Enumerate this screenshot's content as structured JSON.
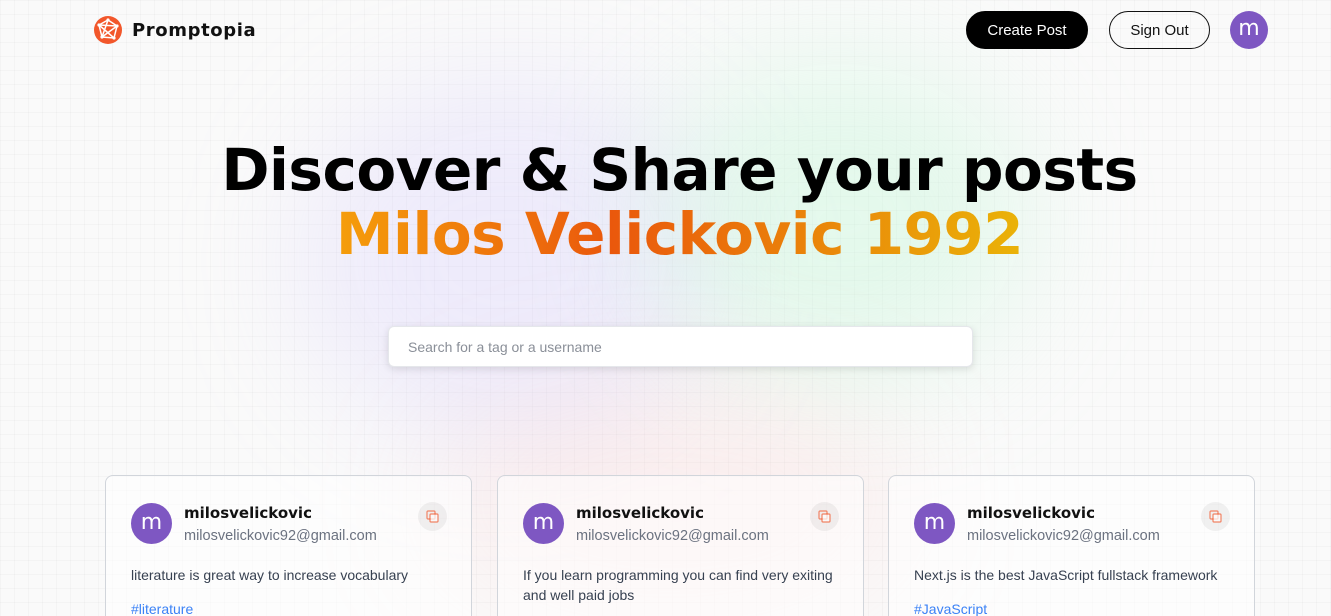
{
  "nav": {
    "logo_text": "Promptopia",
    "create_post_label": "Create Post",
    "sign_out_label": "Sign Out",
    "avatar_initial": "m"
  },
  "hero": {
    "title": "Discover & Share your posts",
    "subtitle": "Milos Velickovic 1992"
  },
  "search": {
    "placeholder": "Search for a tag or a username",
    "value": ""
  },
  "posts": [
    {
      "avatar_initial": "m",
      "username": "milosvelickovic",
      "email": "milosvelickovic92@gmail.com",
      "text": "literature is great way to increase vocabulary",
      "tag": "#literature",
      "copy_icon": "copy-icon"
    },
    {
      "avatar_initial": "m",
      "username": "milosvelickovic",
      "email": "milosvelickovic92@gmail.com",
      "text": "If you learn programming you can find very exiting and well paid jobs",
      "tag": "",
      "copy_icon": "copy-icon"
    },
    {
      "avatar_initial": "m",
      "username": "milosvelickovic",
      "email": "milosvelickovic92@gmail.com",
      "text": "Next.js is the best JavaScript fullstack framework",
      "tag": "#JavaScript",
      "copy_icon": "copy-icon"
    }
  ],
  "colors": {
    "accent_gradient_start": "#f59e0b",
    "accent_gradient_mid": "#ea580c",
    "accent_gradient_end": "#eab308",
    "avatar_bg": "#7e57c2",
    "tag_color": "#3b82f6",
    "logo_orange": "#f2572b"
  }
}
